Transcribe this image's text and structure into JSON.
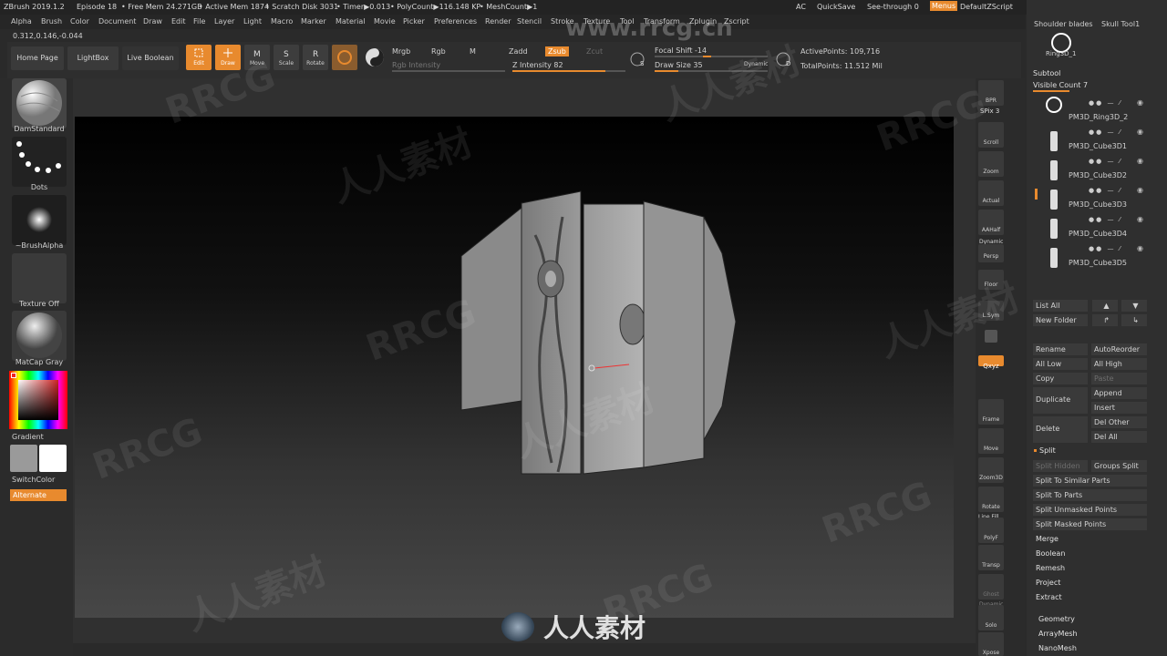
{
  "titlebar": {
    "app": "ZBrush 2019.1.2",
    "episode": "Episode 18",
    "free_mem": "• Free Mem 24.271GB",
    "active_mem": "• Active Mem 1874",
    "scratch": "• Scratch Disk 3031",
    "timer": "• Timer▶0.013",
    "polycount": "• PolyCount▶116.148 KP",
    "meshcount": "• MeshCount▶1",
    "ac": "AC",
    "quicksave": "QuickSave",
    "seethrough": "See-through  0",
    "menus": "Menus",
    "script": "DefaultZScript"
  },
  "menubar": [
    "Alpha",
    "Brush",
    "Color",
    "Document",
    "Draw",
    "Edit",
    "File",
    "Layer",
    "Light",
    "Macro",
    "Marker",
    "Material",
    "Movie",
    "Picker",
    "Preferences",
    "Render",
    "Stencil",
    "Stroke",
    "Texture",
    "Tool",
    "Transform",
    "Zplugin",
    "Zscript"
  ],
  "coords": "0.312,0.146,-0.044",
  "shelf": {
    "home": "Home Page",
    "lightbox": "LightBox",
    "live_boolean": "Live Boolean",
    "edit": "Edit",
    "draw": "Draw",
    "move": "Move",
    "scale": "Scale",
    "rotate": "Rotate",
    "mrgb": "Mrgb",
    "rgb": "Rgb",
    "m": "M",
    "zadd": "Zadd",
    "zsub": "Zsub",
    "zcut": "Zcut",
    "rgb_intensity": "Rgb Intensity",
    "z_intensity": "Z Intensity 82",
    "focal_shift": "Focal Shift -14",
    "draw_size": "Draw Size 35",
    "dynamic": "Dynamic",
    "active_points": "ActivePoints: 109,716",
    "total_points": "TotalPoints: 11.512 Mil",
    "z_intensity_value": 82,
    "draw_size_value": 35,
    "focal_shift_value": -14
  },
  "left": {
    "brush": "DamStandard",
    "stroke": "Dots",
    "alpha": "~BrushAlpha",
    "texture": "Texture Off",
    "material": "MatCap Gray",
    "gradient": "Gradient",
    "switchcolor": "SwitchColor",
    "alternate": "Alternate"
  },
  "rail": {
    "bpr": "BPR",
    "spix": "SPix 3",
    "scroll": "Scroll",
    "zoom": "Zoom",
    "actual": "Actual",
    "aahalf": "AAHalf",
    "dynamic": "Dynamic",
    "persp": "Persp",
    "floor": "Floor",
    "lsym": "L.Sym",
    "xyz": "Qxyz",
    "frame": "Frame",
    "move": "Move",
    "zoom3d": "Zoom3D",
    "rotate": "Rotate",
    "linefill": "Line Fill",
    "polyf": "PolyF",
    "transp": "Transp",
    "ghost": "Ghost",
    "dynamic2": "Dynamic",
    "solo": "Solo",
    "xpose": "Xpose"
  },
  "subtool": {
    "top_names": [
      "Shoulder blades",
      "Skull Tool1",
      "Ring3D_1"
    ],
    "header": "Subtool",
    "visible_count": "Visible Count 7",
    "items": [
      {
        "name": "PM3D_Ring3D_2"
      },
      {
        "name": "PM3D_Cube3D1"
      },
      {
        "name": "PM3D_Cube3D2"
      },
      {
        "name": "PM3D_Cube3D3"
      },
      {
        "name": "PM3D_Cube3D4"
      },
      {
        "name": "PM3D_Cube3D5"
      }
    ],
    "list_all": "List All",
    "new_folder": "New Folder",
    "rename": "Rename",
    "autoreorder": "AutoReorder",
    "all_low": "All Low",
    "all_high": "All High",
    "copy": "Copy",
    "paste": "Paste",
    "duplicate": "Duplicate",
    "append": "Append",
    "insert": "Insert",
    "delete": "Delete",
    "del_other": "Del Other",
    "del_all": "Del All",
    "split": "Split",
    "split_hidden": "Split Hidden",
    "groups_split": "Groups Split",
    "split_similar": "Split To Similar Parts",
    "split_parts": "Split To Parts",
    "split_unmasked": "Split Unmasked Points",
    "split_masked": "Split Masked Points",
    "merge": "Merge",
    "boolean": "Boolean",
    "remesh": "Remesh",
    "project": "Project",
    "extract": "Extract",
    "geometry": "Geometry",
    "arraymesh": "ArrayMesh",
    "nanomesh": "NanoMesh"
  },
  "watermarks": {
    "rrcg": "RRCG",
    "cn": "人人素材",
    "url": "www.rrcg.cn"
  },
  "colors": {
    "accent": "#e88a2e",
    "panel": "#2b2b2b"
  }
}
